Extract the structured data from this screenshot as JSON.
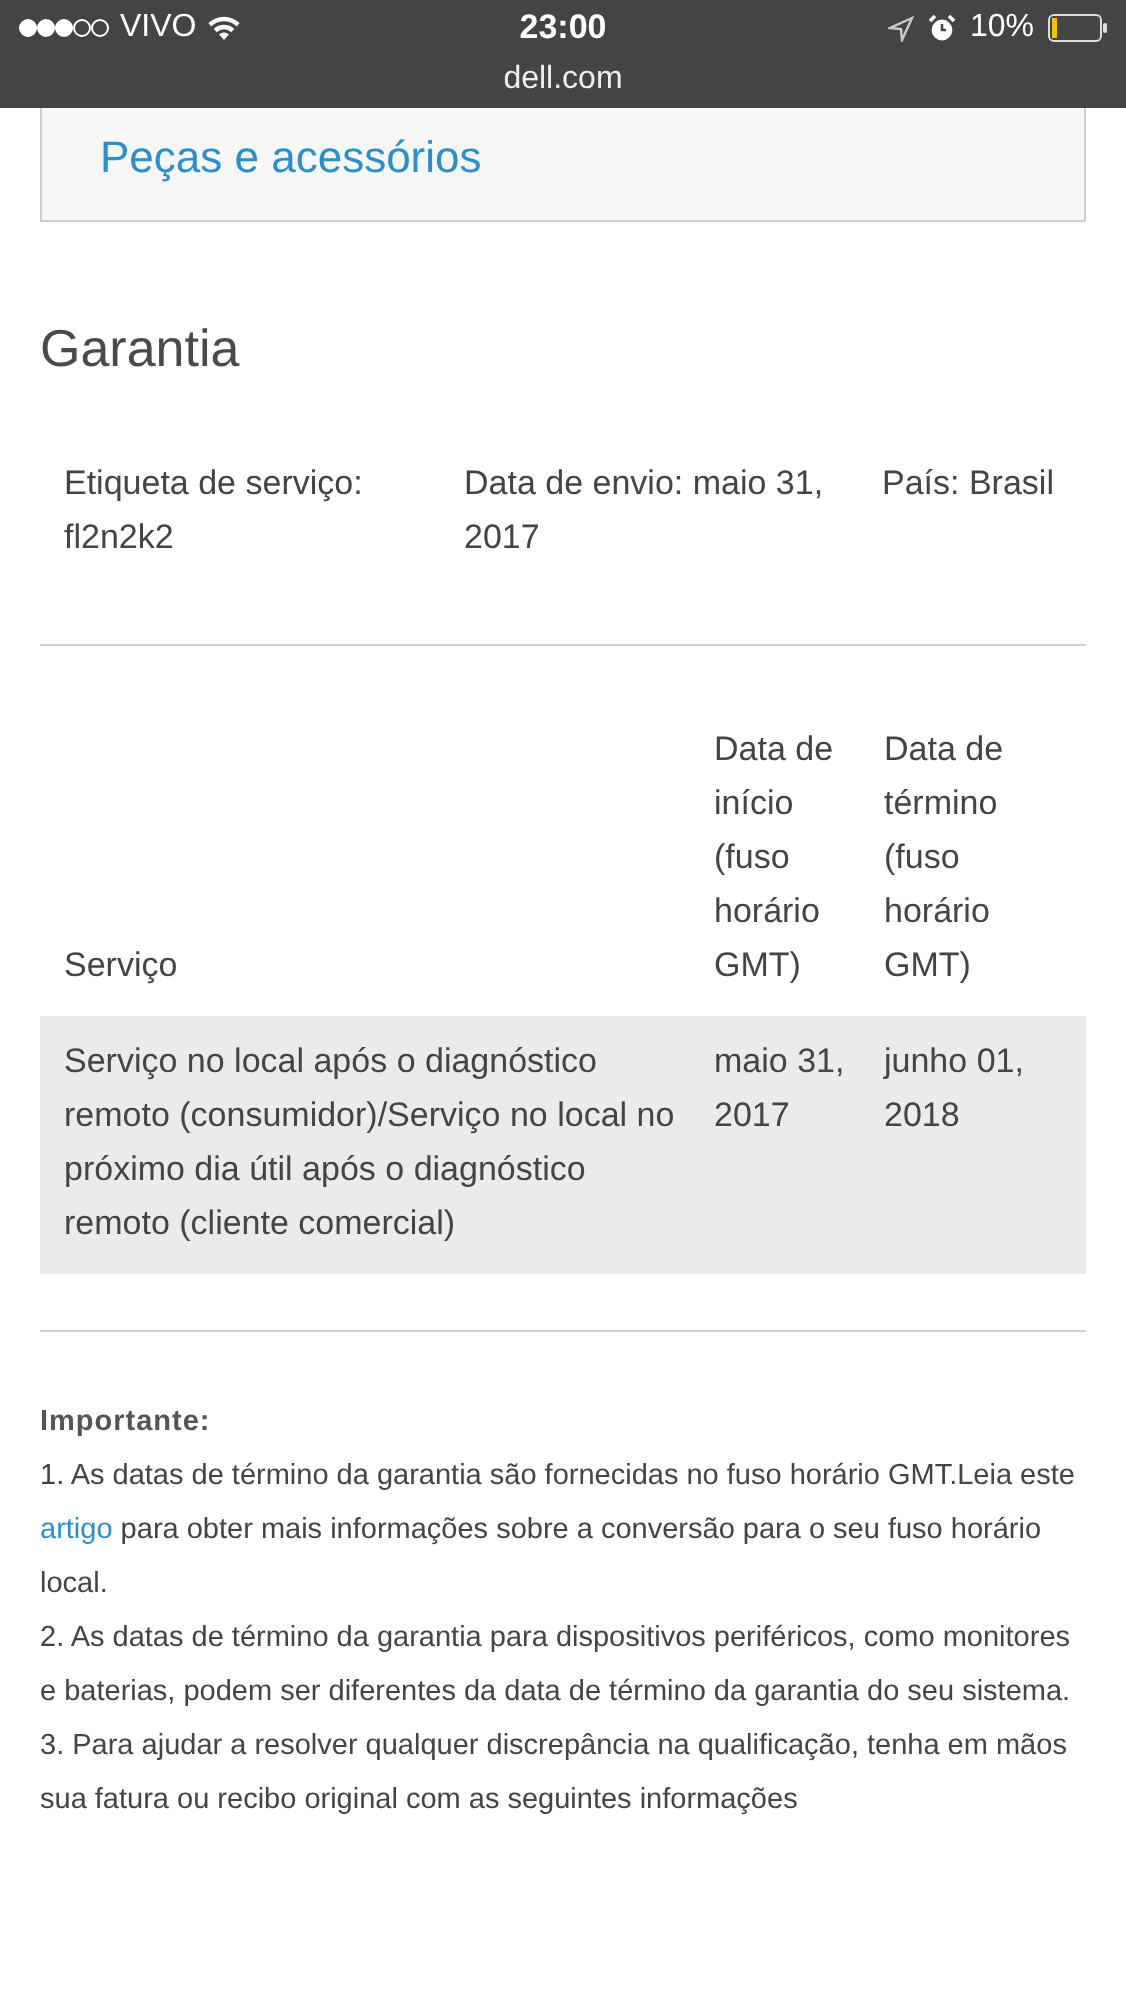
{
  "status_bar": {
    "carrier": "VIVO",
    "time": "23:00",
    "battery": "10%"
  },
  "address_bar": {
    "url": "dell.com"
  },
  "parts_link": {
    "label": "Peças e acessórios"
  },
  "warranty": {
    "title": "Garantia",
    "info": [
      {
        "label": "Etiqueta de serviço:",
        "value": "fl2n2k2"
      },
      {
        "label": "Data de envio:",
        "value": "maio 31, 2017"
      },
      {
        "label": "País:",
        "value": "Brasil"
      }
    ],
    "table": {
      "columns": [
        "Serviço",
        "Data de início (fuso horário GMT)",
        "Data de término (fuso horário GMT)"
      ],
      "rows": [
        {
          "cells": [
            "Serviço no local após o diagnóstico remoto (consumidor)/Serviço no local no próximo dia útil após o diagnóstico remoto (cliente comercial)",
            "maio 31, 2017",
            "junho 01, 2018"
          ]
        }
      ]
    }
  },
  "important": {
    "title": "Importante:",
    "notes": [
      {
        "parts": [
          {
            "kind": "text",
            "text": "1. As datas de término da garantia são fornecidas no fuso horário GMT.Leia este "
          },
          {
            "kind": "link",
            "text": "artigo"
          },
          {
            "kind": "text",
            "text": " para obter mais informações sobre a conversão para o seu fuso horário local."
          }
        ]
      },
      {
        "parts": [
          {
            "kind": "text",
            "text": "2. As datas de término da garantia para dispositivos periféricos, como monitores e baterias, podem ser diferentes da data de término da garantia do seu sistema."
          }
        ]
      },
      {
        "parts": [
          {
            "kind": "text",
            "text": "3. Para ajudar a resolver qualquer discrepância na qualificação, tenha em mãos sua fatura ou recibo original com as seguintes informações"
          }
        ]
      }
    ]
  }
}
